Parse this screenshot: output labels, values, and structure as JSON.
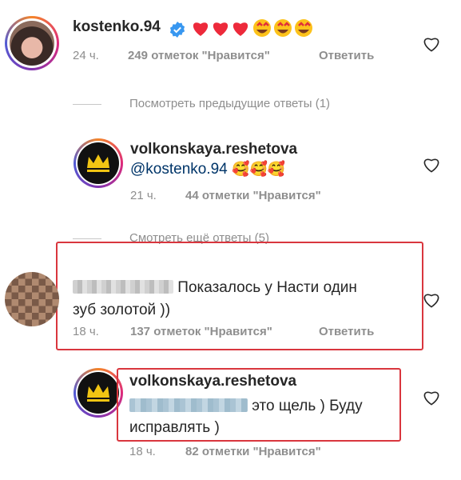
{
  "comments": [
    {
      "username": "kostenko.94",
      "verified": true,
      "text": "❤❤❤😍😍😍",
      "time": "24 ч.",
      "likes": "249 отметок \"Нравится\"",
      "reply_label": "Ответить"
    },
    {
      "username": "volkonskaya.reshetova",
      "mention": "@kostenko.94",
      "text": "🥰🥰🥰",
      "time": "21 ч.",
      "likes": "44 отметки \"Нравится\""
    },
    {
      "text_line1": "Показалось у Насти один",
      "text_line2": "зуб золотой ))",
      "time": "18 ч.",
      "likes": "137 отметок \"Нравится\"",
      "reply_label": "Ответить"
    },
    {
      "username": "volkonskaya.reshetova",
      "text_line1": "это щель ) Буду",
      "text_line2": "исправлять )",
      "time": "18 ч.",
      "likes": "82 отметки \"Нравится\""
    }
  ],
  "view_previous_replies": "Посмотреть предыдущие ответы (1)",
  "view_more_replies": "Смотреть ещё ответы (5)",
  "colors": {
    "highlight": "#d9363e",
    "verified": "#3897f0",
    "heart_emoji": "#ed2a3b"
  }
}
